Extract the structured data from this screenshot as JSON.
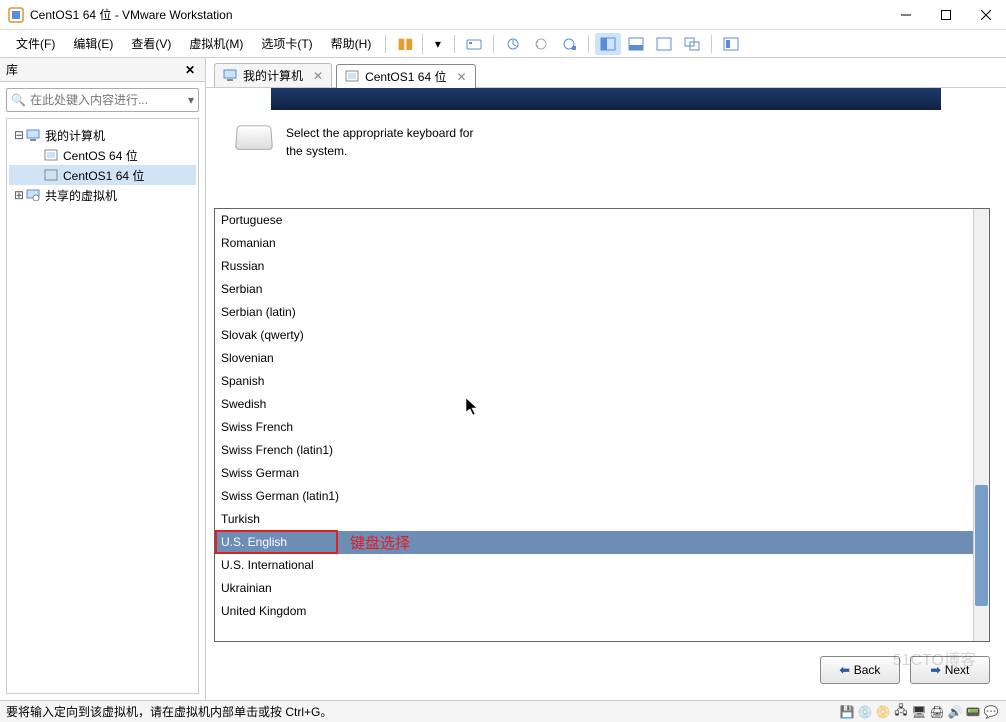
{
  "window": {
    "title": "CentOS1 64 位 - VMware Workstation"
  },
  "menu": {
    "file": "文件(F)",
    "edit": "编辑(E)",
    "view": "查看(V)",
    "vm": "虚拟机(M)",
    "tabs": "选项卡(T)",
    "help": "帮助(H)"
  },
  "sidebar": {
    "title": "库",
    "search_placeholder": "在此处键入内容进行...",
    "tree": {
      "root": "我的计算机",
      "items": [
        "CentOS 64 位",
        "CentOS1 64 位"
      ],
      "shared": "共享的虚拟机"
    }
  },
  "tabs": {
    "home": "我的计算机",
    "active": "CentOS1 64 位"
  },
  "installer": {
    "prompt_line1": "Select the appropriate keyboard for",
    "prompt_line2": "the system.",
    "items": [
      "Portuguese",
      "Romanian",
      "Russian",
      "Serbian",
      "Serbian (latin)",
      "Slovak (qwerty)",
      "Slovenian",
      "Spanish",
      "Swedish",
      "Swiss French",
      "Swiss French (latin1)",
      "Swiss German",
      "Swiss German (latin1)",
      "Turkish",
      "U.S. English",
      "U.S. International",
      "Ukrainian",
      "United Kingdom"
    ],
    "selected_index": 14,
    "back": "Back",
    "next": "Next"
  },
  "annotation": {
    "label": "键盘选择"
  },
  "status": {
    "text": "要将输入定向到该虚拟机，请在虚拟机内部单击或按 Ctrl+G。"
  },
  "watermark": "51CTO博客"
}
